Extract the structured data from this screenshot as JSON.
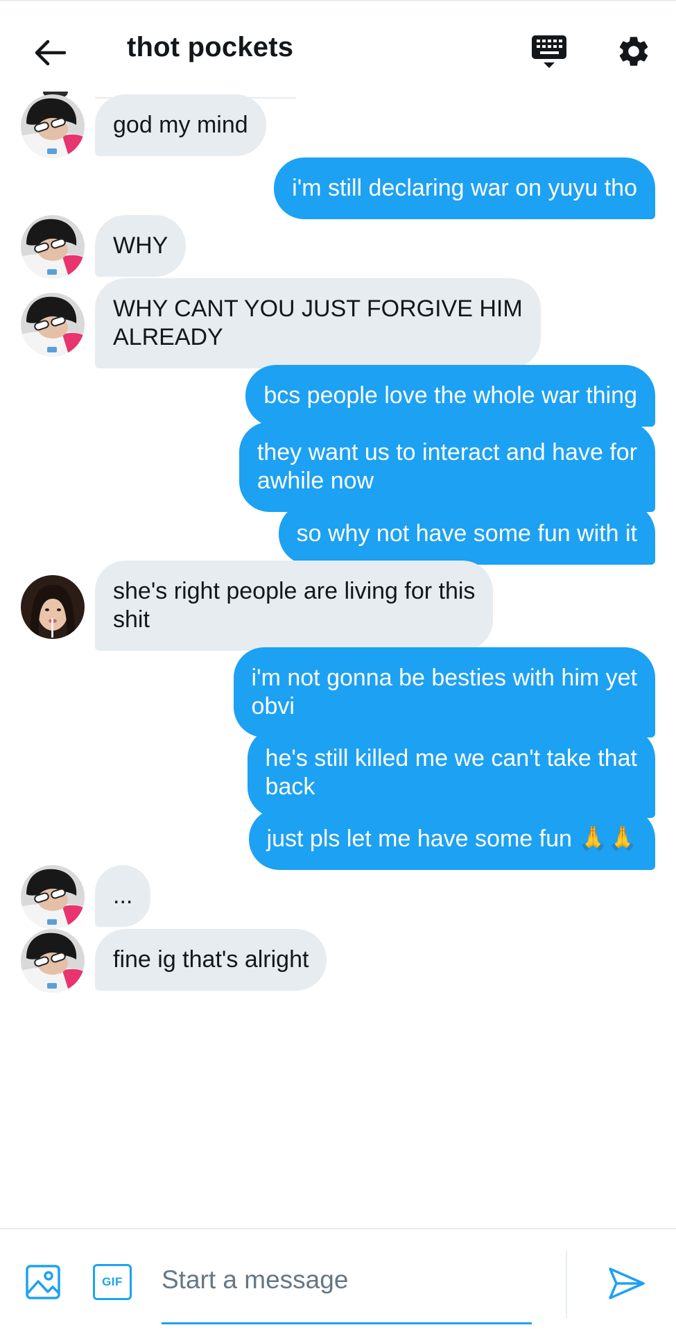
{
  "header": {
    "title": "thot pockets",
    "back_icon": "arrow-left-icon",
    "keyboard_icon": "keyboard-icon",
    "settings_icon": "gear-icon"
  },
  "colors": {
    "accent": "#1da1f2",
    "incoming_bubble": "#e6ecf0",
    "text": "#14171a",
    "placeholder": "#657786"
  },
  "messages": [
    {
      "dir": "in",
      "avatar": "avatar-a",
      "text": "god my mind"
    },
    {
      "dir": "out",
      "text": "i'm still declaring war on yuyu tho"
    },
    {
      "dir": "in",
      "avatar": "avatar-a",
      "text": "WHY"
    },
    {
      "dir": "in",
      "avatar": "avatar-a",
      "text": "WHY CANT YOU JUST FORGIVE HIM\nALREADY"
    },
    {
      "dir": "out",
      "text": "bcs people love the whole war thing"
    },
    {
      "dir": "out",
      "text": "they want us to interact and have for\nawhile now"
    },
    {
      "dir": "out",
      "text": "so why not have some fun with it"
    },
    {
      "dir": "in",
      "avatar": "avatar-b",
      "text": "she's right people are living for this\nshit"
    },
    {
      "dir": "out",
      "text": "i'm not gonna be besties with him yet\nobvi"
    },
    {
      "dir": "out",
      "text": "he's still killed me we can't take that\nback"
    },
    {
      "dir": "out",
      "text": "just pls let me have some fun 🙏🙏"
    },
    {
      "dir": "in",
      "avatar": "avatar-a",
      "text": "..."
    },
    {
      "dir": "in",
      "avatar": "avatar-a",
      "text": "fine ig that's alright"
    }
  ],
  "composer": {
    "placeholder": "Start a message",
    "value": "",
    "gif_label": "GIF",
    "media_icon": "image-icon",
    "send_icon": "send-icon"
  }
}
